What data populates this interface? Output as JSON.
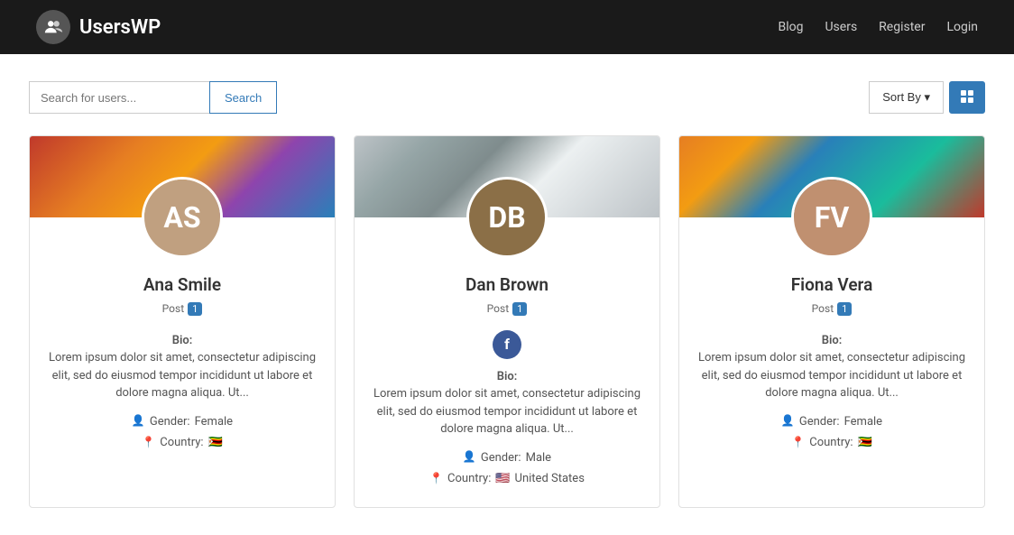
{
  "header": {
    "logo_text": "UsersWP",
    "nav": [
      {
        "label": "Blog",
        "href": "#"
      },
      {
        "label": "Users",
        "href": "#"
      },
      {
        "label": "Register",
        "href": "#"
      },
      {
        "label": "Login",
        "href": "#"
      }
    ]
  },
  "search": {
    "placeholder": "Search for users...",
    "button_label": "Search",
    "sort_label": "Sort By",
    "sort_icon": "▾"
  },
  "users": [
    {
      "name": "Ana Smile",
      "post_label": "Post",
      "post_count": "1",
      "bio_label": "Bio:",
      "bio_text": "Lorem ipsum dolor sit amet, consectetur adipiscing elit, sed do eiusmod tempor incididunt ut labore et dolore magna aliqua. Ut...",
      "gender_label": "Gender:",
      "gender_value": "Female",
      "country_label": "Country:",
      "country_flag": "🇿🇼",
      "has_social": false,
      "avatar_color": "#c0a080",
      "banner_class": "banner-1"
    },
    {
      "name": "Dan Brown",
      "post_label": "Post",
      "post_count": "1",
      "bio_label": "Bio:",
      "bio_text": "Lorem ipsum dolor sit amet, consectetur adipiscing elit, sed do eiusmod tempor incididunt ut labore et dolore magna aliqua. Ut...",
      "gender_label": "Gender:",
      "gender_value": "Male",
      "country_label": "Country:",
      "country_flag": "🇺🇸",
      "country_name": "United States",
      "has_social": true,
      "avatar_color": "#8b6f47",
      "banner_class": "banner-2"
    },
    {
      "name": "Fiona Vera",
      "post_label": "Post",
      "post_count": "1",
      "bio_label": "Bio:",
      "bio_text": "Lorem ipsum dolor sit amet, consectetur adipiscing elit, sed do eiusmod tempor incididunt ut labore et dolore magna aliqua. Ut...",
      "gender_label": "Gender:",
      "gender_value": "Female",
      "country_label": "Country:",
      "country_flag": "🇿🇼",
      "has_social": false,
      "avatar_color": "#c09070",
      "banner_class": "banner-3"
    }
  ]
}
